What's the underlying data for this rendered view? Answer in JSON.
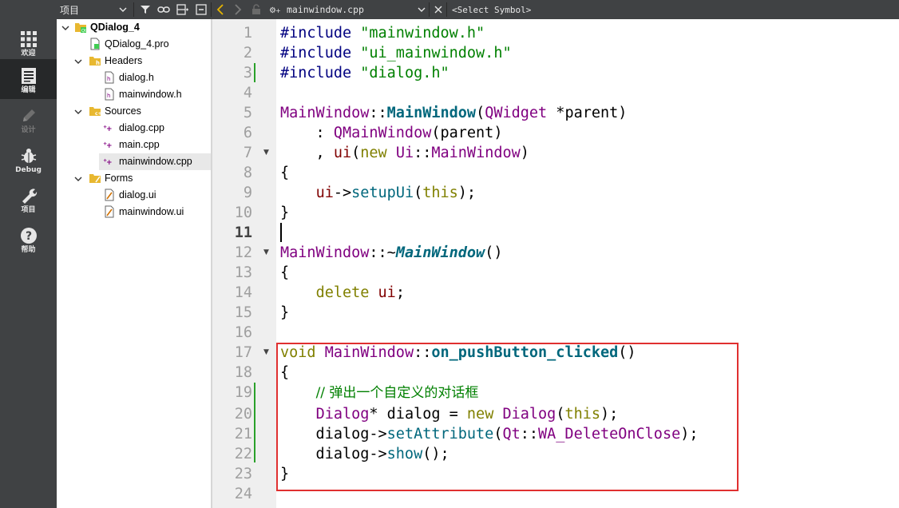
{
  "modebar": {
    "items": [
      {
        "label": "欢迎",
        "icon": "grid-icon"
      },
      {
        "label": "编辑",
        "icon": "edit-doc-icon",
        "active": true
      },
      {
        "label": "设计",
        "icon": "pencil-icon",
        "disabled": true
      },
      {
        "label": "Debug",
        "icon": "bug-icon"
      },
      {
        "label": "项目",
        "icon": "wrench-icon"
      },
      {
        "label": "帮助",
        "icon": "help-icon"
      }
    ]
  },
  "toolbar": {
    "panel_title": "项目",
    "file_name": "mainwindow.cpp",
    "symbol_selector": "<Select Symbol>"
  },
  "tree": {
    "project": "QDialog_4",
    "pro_file": "QDialog_4.pro",
    "headers": "Headers",
    "header_files": [
      "dialog.h",
      "mainwindow.h"
    ],
    "sources": "Sources",
    "source_files": [
      "dialog.cpp",
      "main.cpp",
      "mainwindow.cpp"
    ],
    "forms": "Forms",
    "form_files": [
      "dialog.ui",
      "mainwindow.ui"
    ]
  },
  "editor": {
    "line_numbers": [
      "1",
      "2",
      "3",
      "4",
      "5",
      "6",
      "7",
      "8",
      "9",
      "10",
      "11",
      "12",
      "13",
      "14",
      "15",
      "16",
      "17",
      "18",
      "19",
      "20",
      "21",
      "22",
      "23",
      "24"
    ],
    "current_line": "11",
    "code": {
      "l1a": "#include",
      "l1b": "\"mainwindow.h\"",
      "l2a": "#include",
      "l2b": "\"ui_mainwindow.h\"",
      "l3a": "#include",
      "l3b": "\"dialog.h\"",
      "l5a": "MainWindow",
      "l5b": "::",
      "l5c": "MainWindow",
      "l5d": "(",
      "l5e": "QWidget",
      "l5f": " *parent)",
      "l6a": "    : ",
      "l6b": "QMainWindow",
      "l6c": "(parent)",
      "l7a": "    , ",
      "l7b": "ui",
      "l7c": "(",
      "l7d": "new",
      "l7e": " ",
      "l7f": "Ui",
      "l7g": "::",
      "l7h": "MainWindow",
      "l7i": ")",
      "l8": "{",
      "l9a": "    ",
      "l9b": "ui",
      "l9c": "->",
      "l9d": "setupUi",
      "l9e": "(",
      "l9f": "this",
      "l9g": ");",
      "l10": "}",
      "l12a": "MainWindow",
      "l12b": "::~",
      "l12c": "MainWindow",
      "l12d": "()",
      "l13": "{",
      "l14a": "    ",
      "l14b": "delete",
      "l14c": " ",
      "l14d": "ui",
      "l14e": ";",
      "l15": "}",
      "l17a": "void",
      "l17b": " ",
      "l17c": "MainWindow",
      "l17d": "::",
      "l17e": "on_pushButton_clicked",
      "l17f": "()",
      "l18": "{",
      "l19a": "    ",
      "l19b": "// 弹出一个自定义的对话框",
      "l20a": "    ",
      "l20b": "Dialog",
      "l20c": "* dialog = ",
      "l20d": "new",
      "l20e": " ",
      "l20f": "Dialog",
      "l20g": "(",
      "l20h": "this",
      "l20i": ");",
      "l21a": "    dialog->",
      "l21b": "setAttribute",
      "l21c": "(",
      "l21d": "Qt",
      "l21e": "::",
      "l21f": "WA_DeleteOnClose",
      "l21g": ");",
      "l22a": "    dialog->",
      "l22b": "show",
      "l22c": "();",
      "l23": "}"
    }
  },
  "colors": {
    "modebar_bg": "#404244",
    "modebar_active": "#262829",
    "gutter_bg": "#efefef",
    "highlight_border": "#e03030",
    "change_marker": "#2aa12a"
  }
}
